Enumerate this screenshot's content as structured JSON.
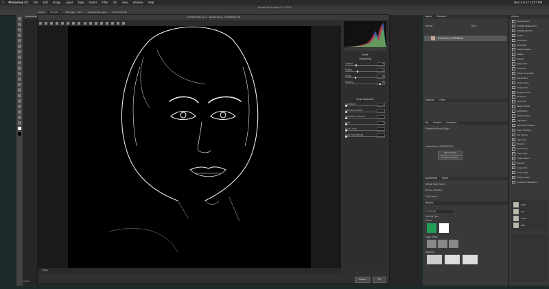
{
  "menubar": {
    "app": "Photoshop CC",
    "items": [
      "File",
      "Edit",
      "Image",
      "Layer",
      "Type",
      "Select",
      "Filter",
      "3D",
      "View",
      "Window",
      "Help"
    ],
    "clock": "Mon Jun 17 12:07 PM"
  },
  "window_title": "Adobe Photoshop CC 2019",
  "options_bar": {
    "mode_label": "Mode:",
    "mode_value": "Normal",
    "strength_label": "Strength:",
    "strength_value": "50%",
    "sample_all": "Sample All Layers",
    "protect": "Protect Detail"
  },
  "document_tab": "shutterstock_1078065033.tif",
  "dialog": {
    "title": "Camera Raw 11.2 – shutterstock_1078065033.tif",
    "zoom": "100%",
    "cancel": "Cancel",
    "ok": "OK",
    "panel_title": "Detail",
    "sharpening": {
      "title": "Sharpening",
      "sliders": [
        {
          "label": "Amount",
          "value": "40",
          "fraction": 0.27
        },
        {
          "label": "Radius",
          "value": "1.0",
          "fraction": 0.3
        },
        {
          "label": "Detail",
          "value": "25",
          "fraction": 0.25
        },
        {
          "label": "Masking",
          "value": "90",
          "fraction": 0.9
        }
      ]
    },
    "noise": {
      "title": "Noise Reduction",
      "sliders": [
        {
          "label": "Luminance",
          "value": "0",
          "fraction": 0
        },
        {
          "label": "Luminance Detail",
          "value": "",
          "fraction": 0
        },
        {
          "label": "Luminance Contrast",
          "value": "",
          "fraction": 0
        },
        {
          "label": "Color",
          "value": "0",
          "fraction": 0
        },
        {
          "label": "Color Detail",
          "value": "",
          "fraction": 0
        },
        {
          "label": "Color Smoothness",
          "value": "",
          "fraction": 0
        }
      ]
    }
  },
  "layers_panel": {
    "tabs": [
      "Layers",
      "Channels"
    ],
    "blend": "Normal",
    "opacity": "100%",
    "layer_name": "shutterstock_1078065033"
  },
  "paths_panel": {
    "tabs": [
      "Swatches",
      "Paths"
    ]
  },
  "properties": {
    "tabs": [
      "Libr",
      "Brushes",
      "Properties"
    ],
    "header": "Embedded Smart Object",
    "file": "shutterstock_1078065033.tif",
    "edit_btn": "Edit Contents",
    "convert_btn": "Convert to Linked..."
  },
  "adjustments": {
    "tabs": [
      "Adjustments",
      "Styles"
    ],
    "items": [
      "Default Style (None)",
      "BEVEL CENTER",
      "Thick Bevel"
    ]
  },
  "libraries": {
    "title": "Libraries",
    "search": "LOGO-GM",
    "view": "View by Type",
    "colors_label": "Colors",
    "layer_styles_label": "Layer Styles",
    "graphics_label": "Graphics",
    "colors": [
      "#1f9d55",
      "#ffffff"
    ]
  },
  "history": {
    "title": "Actions",
    "items": [
      "Vertical Mirror",
      "FRAME SELECTION",
      "FRAME PHOTO",
      "SOLID",
      "Grid Slave",
      "Spiral Flip",
      "Darken Lighten",
      "Hotkey",
      "Artwork",
      "SAVE JPG",
      "Reflection",
      "Stroke Drop Shad",
      "Coral Nano",
      "Clean Stroke",
      "Simple Edit",
      "Vintage Comp",
      "3D Fancy",
      "Layer Fill",
      "Black & White",
      "Add Border",
      "Shading Effect",
      "Light Rays",
      "High Pass Sharpen",
      "Layer Via Copy",
      "Set Current",
      "High Pass",
      "Sharpen",
      "Blend Scrpt",
      "Layer Style",
      "Group Layers",
      "Save As",
      "Image Size",
      "Crop Image",
      "Flatten Image",
      "Frequency Separation"
    ]
  },
  "channels_mini": [
    "RGB",
    "Red",
    "Green",
    "Blue"
  ],
  "statusbar": "100%"
}
